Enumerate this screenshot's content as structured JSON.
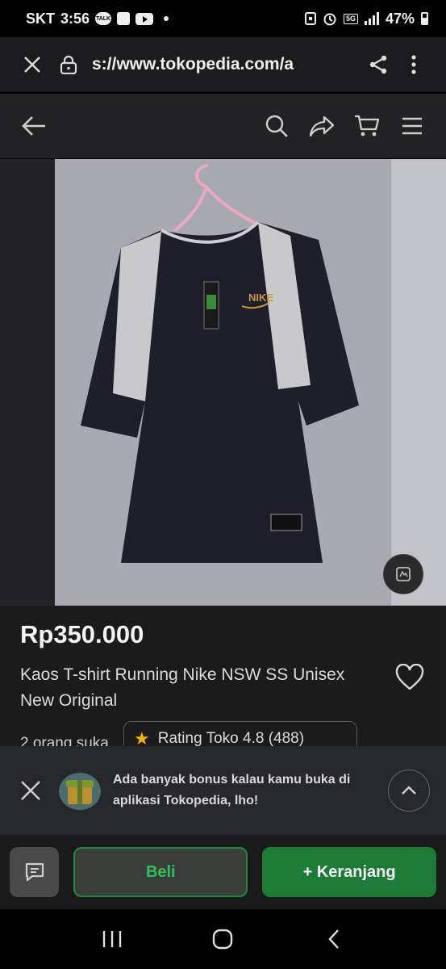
{
  "status_bar": {
    "carrier": "SKT",
    "time": "3:56",
    "talk_badge": "TALK",
    "network": "5G",
    "battery": "47%"
  },
  "browser": {
    "url": "s://www.tokopedia.com/a"
  },
  "product": {
    "price": "Rp350.000",
    "title": "Kaos T-shirt Running Nike NSW SS Unisex New Original",
    "likes": "2 orang suka",
    "rating": "Rating Toko 4.8 (488)"
  },
  "promo": {
    "message": "Ada banyak bonus kalau kamu buka di aplikasi Tokopedia, lho!"
  },
  "actions": {
    "buy_label": "Beli",
    "cart_label": "+ Keranjang"
  },
  "colors": {
    "accent_green": "#1e7a37",
    "buy_text": "#2fbf5c",
    "star": "#f5b400"
  }
}
